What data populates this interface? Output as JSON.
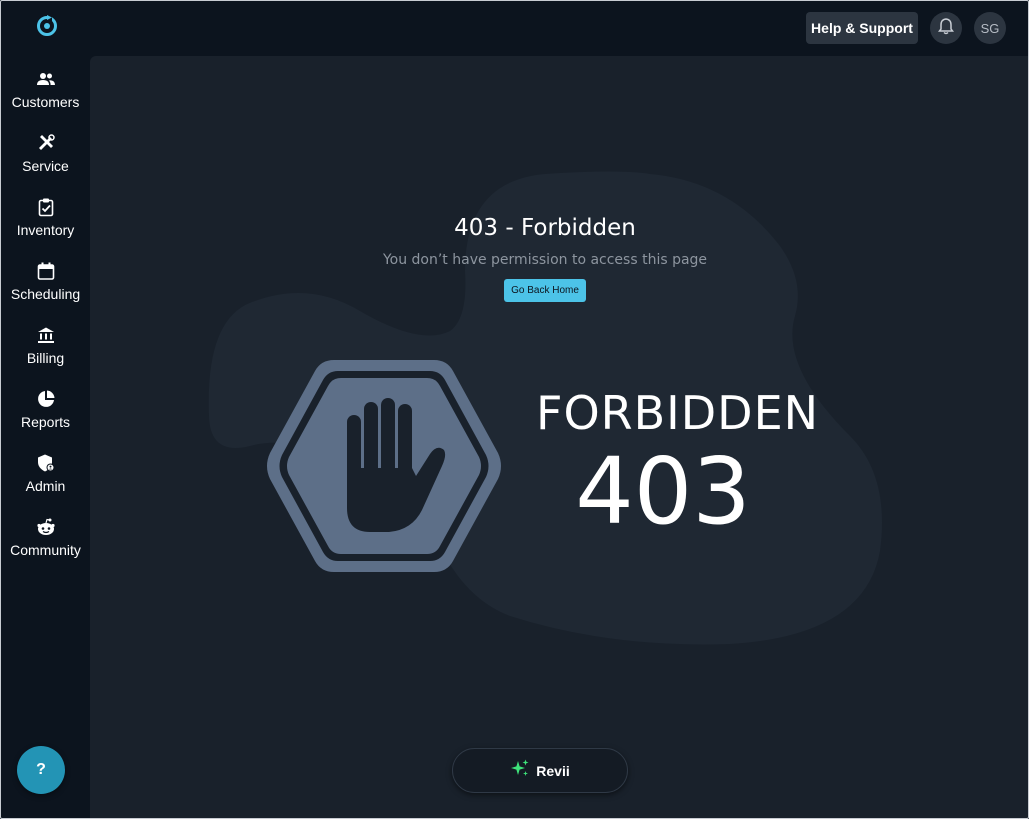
{
  "sidebar": {
    "items": [
      {
        "label": "Customers",
        "icon": "customers-icon"
      },
      {
        "label": "Service",
        "icon": "service-tools-icon"
      },
      {
        "label": "Inventory",
        "icon": "inventory-clipboard-icon"
      },
      {
        "label": "Scheduling",
        "icon": "calendar-icon"
      },
      {
        "label": "Billing",
        "icon": "bank-icon"
      },
      {
        "label": "Reports",
        "icon": "pie-chart-icon"
      },
      {
        "label": "Admin",
        "icon": "admin-shield-icon"
      },
      {
        "label": "Community",
        "icon": "community-icon"
      }
    ],
    "help_fab_label": "?"
  },
  "topbar": {
    "help_label": "Help & Support",
    "avatar_initials": "SG"
  },
  "error": {
    "title": "403 - Forbidden",
    "message": "You don’t have permission to access this page",
    "home_button": "Go Back Home",
    "illustration_word": "FORBIDDEN",
    "illustration_code": "403"
  },
  "assistant": {
    "label": "Revii"
  },
  "colors": {
    "accent": "#4cc3e8",
    "background": "#0c141e",
    "main_panel": "#19212b",
    "stop_sign": "#5d6f88",
    "sparkle": "#3ee27a"
  }
}
